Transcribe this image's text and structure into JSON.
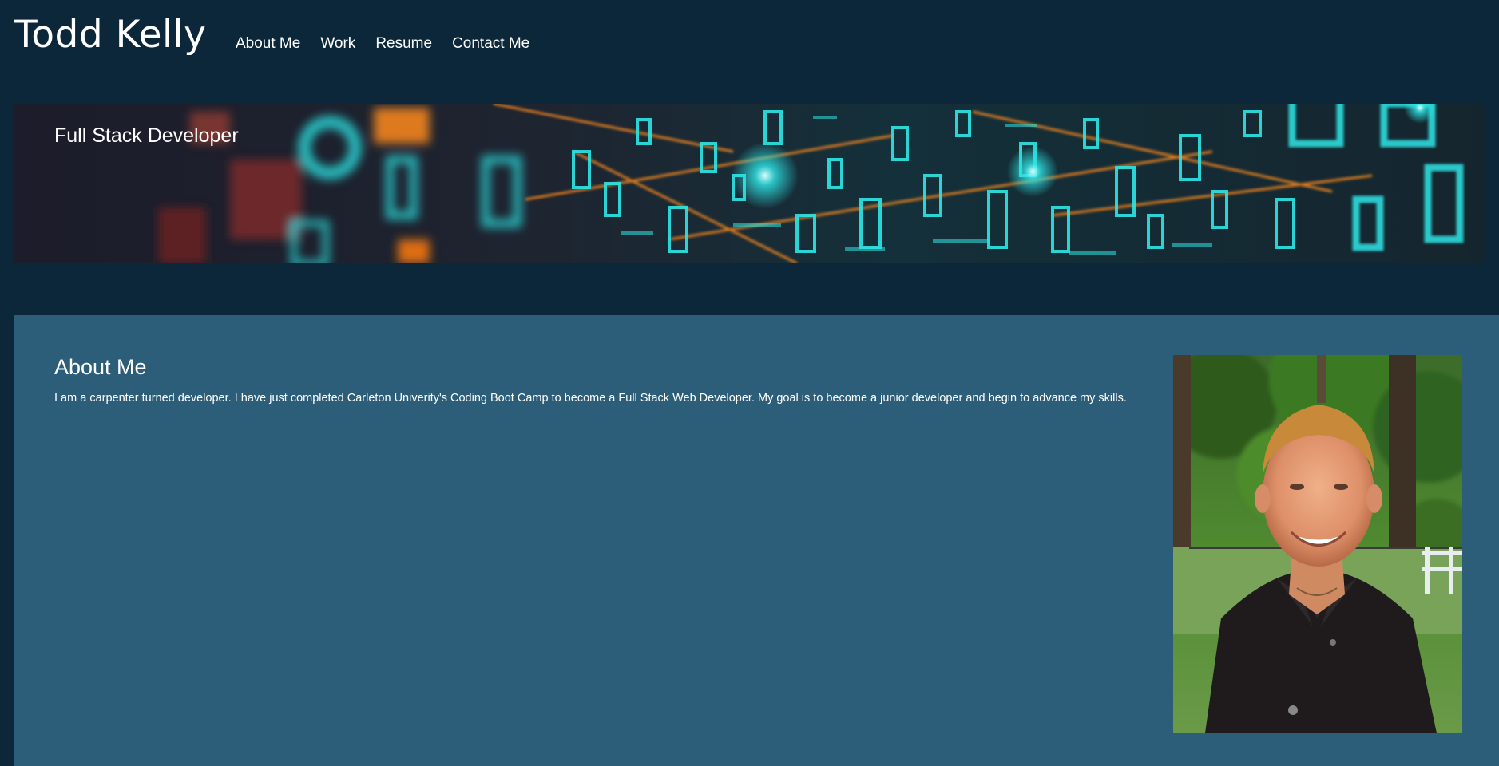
{
  "header": {
    "site_title": "Todd Kelly",
    "nav": [
      {
        "label": "About Me"
      },
      {
        "label": "Work"
      },
      {
        "label": "Resume"
      },
      {
        "label": "Contact Me"
      }
    ]
  },
  "hero": {
    "title": "Full Stack Developer"
  },
  "about": {
    "heading": "About Me",
    "text": "I am a carpenter turned developer. I have just completed Carleton Univerity's Coding Boot Camp to become a Full Stack Web Developer. My goal is to become a junior developer and begin to advance my skills."
  },
  "colors": {
    "page_background": "#0b2739",
    "about_background": "#2c5e7a",
    "hero_accent_cyan": "#2ee6e6",
    "hero_accent_orange": "#ff8a1e",
    "text": "#ffffff"
  }
}
